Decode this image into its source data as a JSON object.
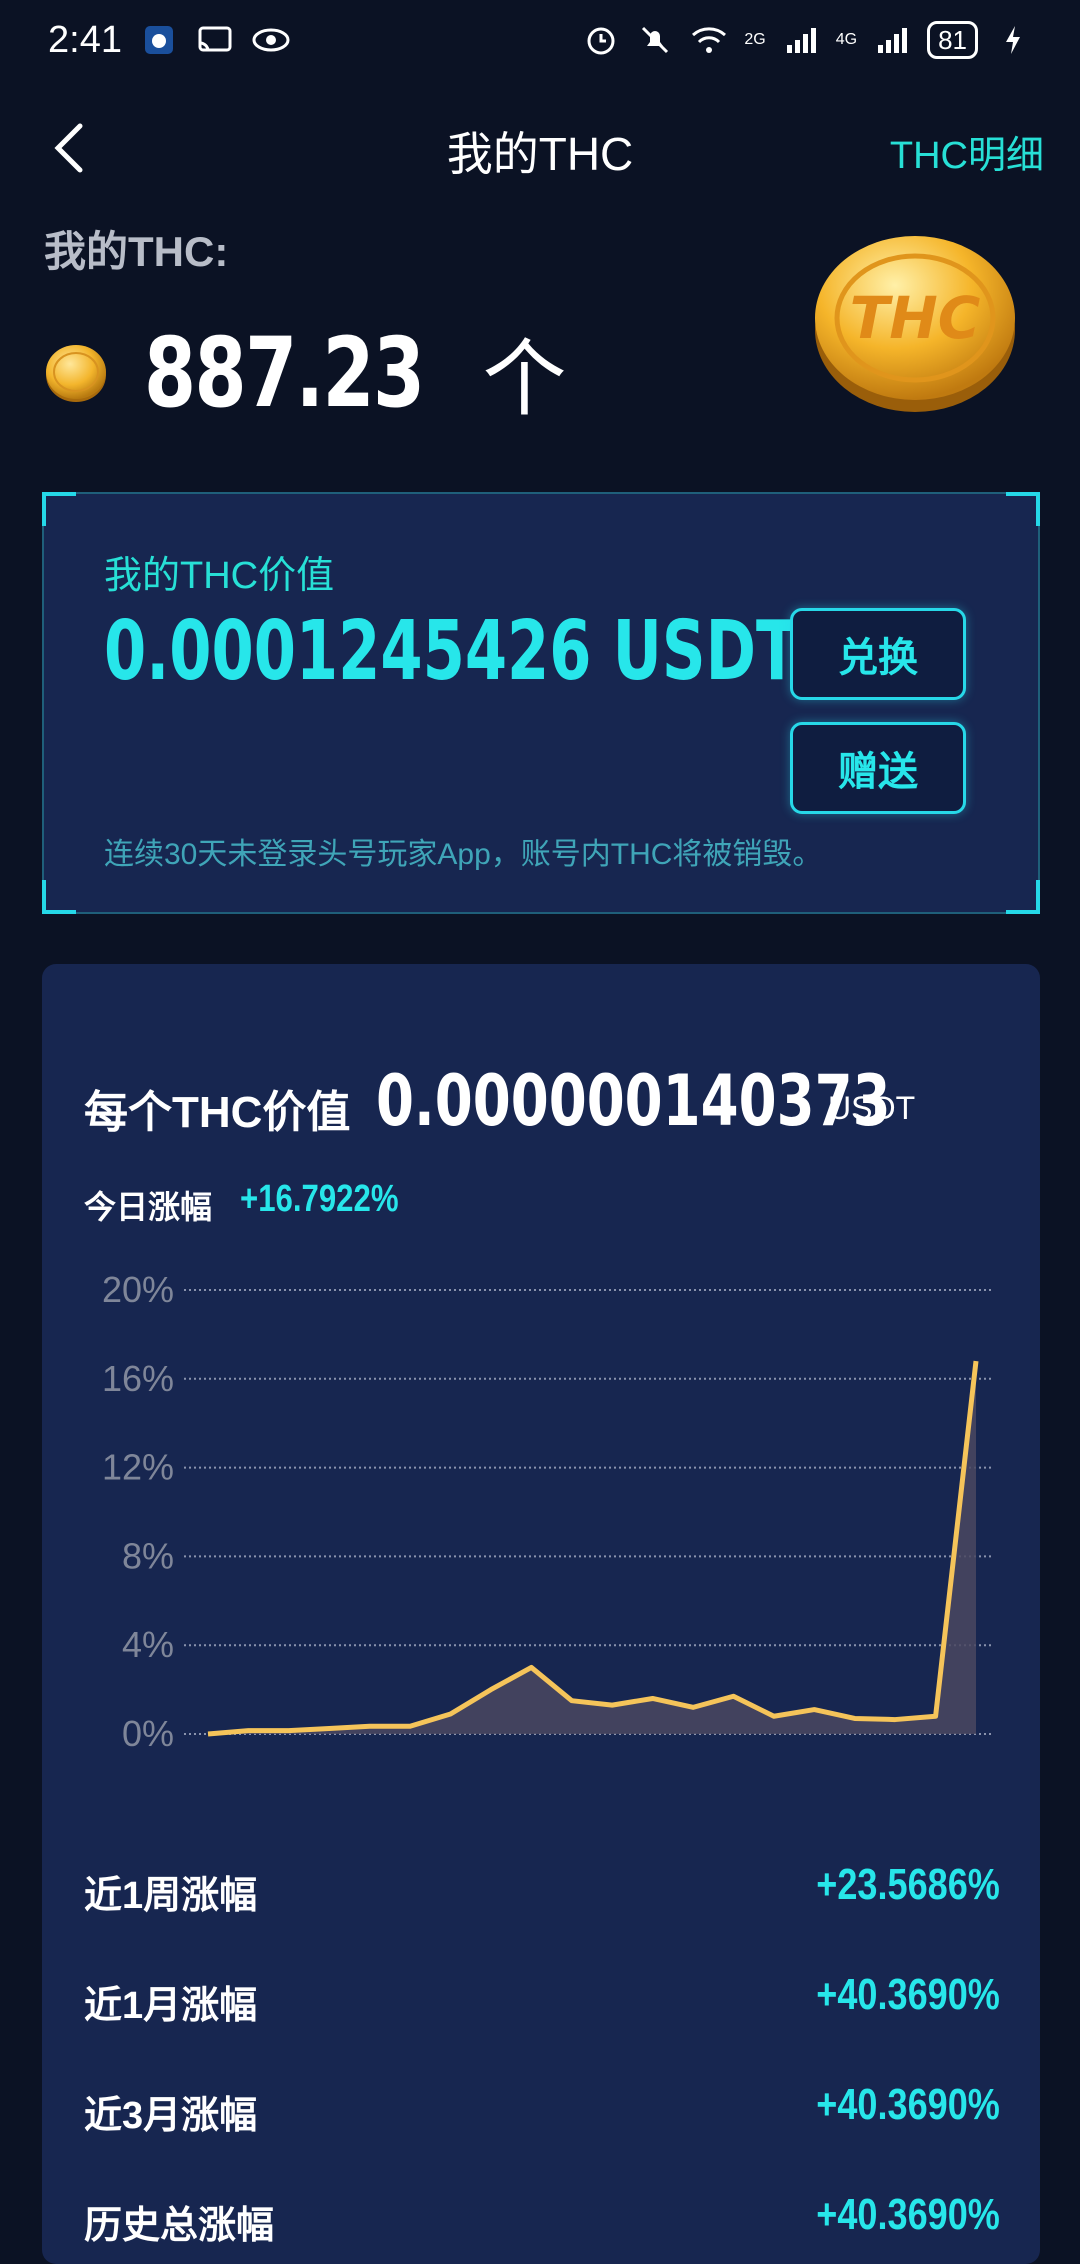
{
  "status_bar": {
    "time": "2:41",
    "net1": "2G",
    "net2": "4G",
    "battery": "81"
  },
  "header": {
    "title": "我的THC",
    "detail_link": "THC明细"
  },
  "balance": {
    "label": "我的THC:",
    "amount": "887.23",
    "unit": "个"
  },
  "value_card": {
    "label": "我的THC价值",
    "value": "0.0001245426 USDT",
    "exchange_button": "兑换",
    "gift_button": "赠送",
    "note": "连续30天未登录头号玩家App，账号内THC将被销毁。"
  },
  "price_card": {
    "unit_label": "每个THC价值",
    "unit_price": "0.000000140373",
    "unit_currency": "USDT",
    "today_label": "今日涨幅",
    "today_value": "+16.7922%"
  },
  "chart_data": {
    "type": "area",
    "y_ticks": [
      "20%",
      "16%",
      "12%",
      "8%",
      "4%",
      "0%"
    ],
    "ylim": [
      0,
      20
    ],
    "values": [
      0,
      0.15,
      0.15,
      0.25,
      0.35,
      0.35,
      0.9,
      2.0,
      3.0,
      1.5,
      1.3,
      1.6,
      1.2,
      1.7,
      0.8,
      1.1,
      0.7,
      0.65,
      0.8,
      16.8
    ],
    "line_color": "#f5c45a",
    "fill_color": "#4a4860",
    "grid": true
  },
  "stats": [
    {
      "label": "近1周涨幅",
      "value": "+23.5686%"
    },
    {
      "label": "近1月涨幅",
      "value": "+40.3690%"
    },
    {
      "label": "近3月涨幅",
      "value": "+40.3690%"
    },
    {
      "label": "历史总涨幅",
      "value": "+40.3690%"
    }
  ],
  "coin_text": "THC"
}
